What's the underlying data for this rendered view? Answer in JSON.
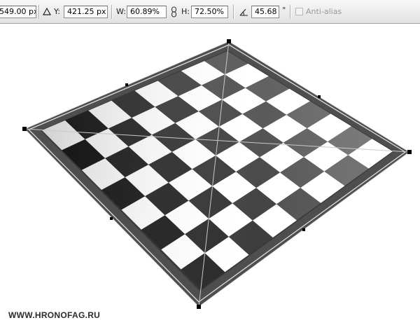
{
  "toolbar": {
    "x_value": "549.00 px",
    "y_label": "Y:",
    "y_value": "421.25 px",
    "w_label": "W:",
    "w_value": "60.89%",
    "h_label": "H:",
    "h_value": "72.50%",
    "angle_value": "45.68",
    "degree_symbol": "°",
    "antialias_label": "Anti-alias",
    "antialias_checked": false
  },
  "icons": {
    "delta": "delta-icon",
    "link": "link-chain-icon",
    "angle": "rotate-angle-icon"
  },
  "canvas": {
    "board": "checkerboard-image",
    "transform": "distort-transform-handles"
  },
  "watermark": "WWW.HRONOFAG.RU"
}
